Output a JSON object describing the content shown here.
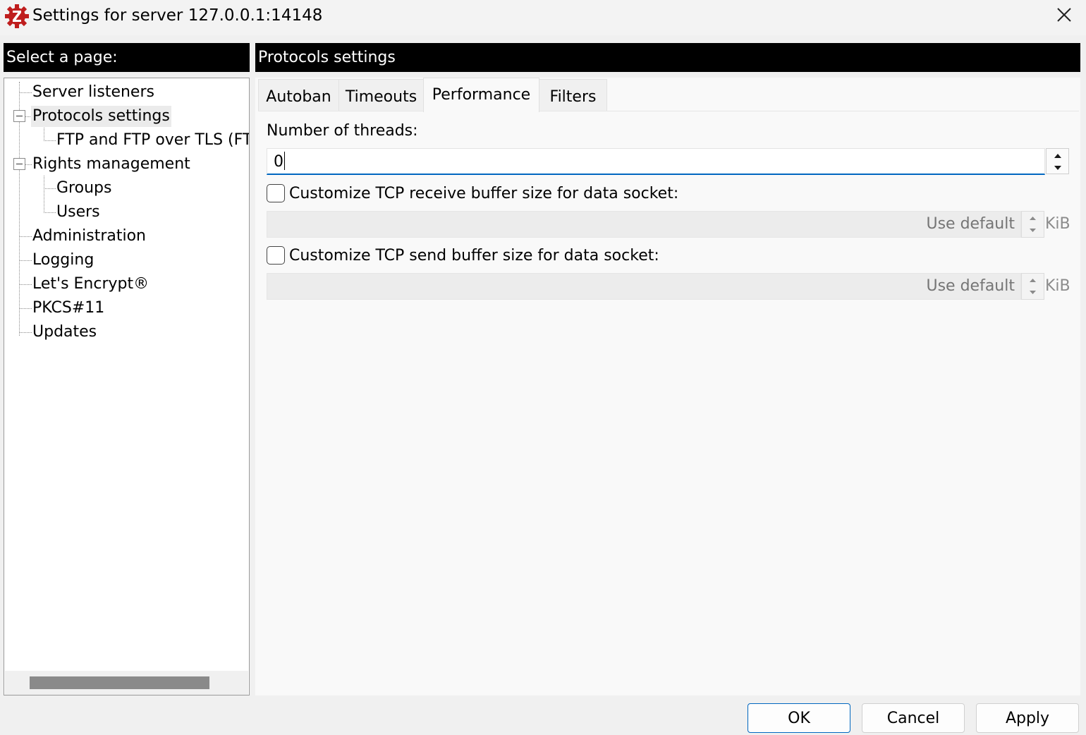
{
  "window": {
    "title": "Settings for server 127.0.0.1:14148",
    "icon": "filezilla-logo-icon",
    "close_icon": "close-icon"
  },
  "left_panel": {
    "header": "Select a page:",
    "tree": [
      {
        "label": "Server listeners",
        "level": 0
      },
      {
        "label": "Protocols settings",
        "level": 0,
        "expanded": true,
        "selected": true
      },
      {
        "label": "FTP and FTP over TLS (FTPS)",
        "level": 1
      },
      {
        "label": "Rights management",
        "level": 0,
        "expanded": true
      },
      {
        "label": "Groups",
        "level": 1
      },
      {
        "label": "Users",
        "level": 1
      },
      {
        "label": "Administration",
        "level": 0
      },
      {
        "label": "Logging",
        "level": 0
      },
      {
        "label": "Let's Encrypt®",
        "level": 0
      },
      {
        "label": "PKCS#11",
        "level": 0
      },
      {
        "label": "Updates",
        "level": 0
      }
    ]
  },
  "right_panel": {
    "header": "Protocols settings",
    "tabs": [
      {
        "label": "Autoban",
        "active": false
      },
      {
        "label": "Timeouts",
        "active": false
      },
      {
        "label": "Performance",
        "active": true
      },
      {
        "label": "Filters",
        "active": false
      }
    ],
    "performance": {
      "threads_label": "Number of threads:",
      "threads_value": "0",
      "receive_checkbox_label": "Customize TCP receive buffer size for data socket:",
      "receive_checked": false,
      "receive_value": "Use default",
      "receive_unit": "KiB",
      "send_checkbox_label": "Customize TCP send buffer size for data socket:",
      "send_checked": false,
      "send_value": "Use default",
      "send_unit": "KiB"
    }
  },
  "buttons": {
    "ok": "OK",
    "cancel": "Cancel",
    "apply": "Apply"
  },
  "colors": {
    "header_bg": "#000000",
    "accent": "#0067c0",
    "logo_red": "#bf1e1e"
  }
}
